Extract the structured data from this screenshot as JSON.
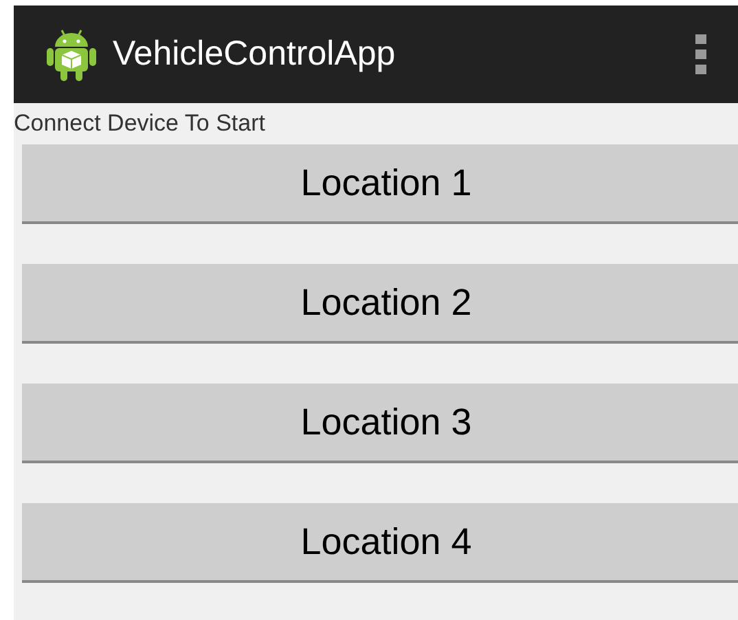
{
  "action_bar": {
    "title": "VehicleControlApp"
  },
  "status_text": "Connect Device To Start",
  "buttons": [
    {
      "label": "Location 1"
    },
    {
      "label": "Location 2"
    },
    {
      "label": "Location 3"
    },
    {
      "label": "Location 4"
    }
  ]
}
